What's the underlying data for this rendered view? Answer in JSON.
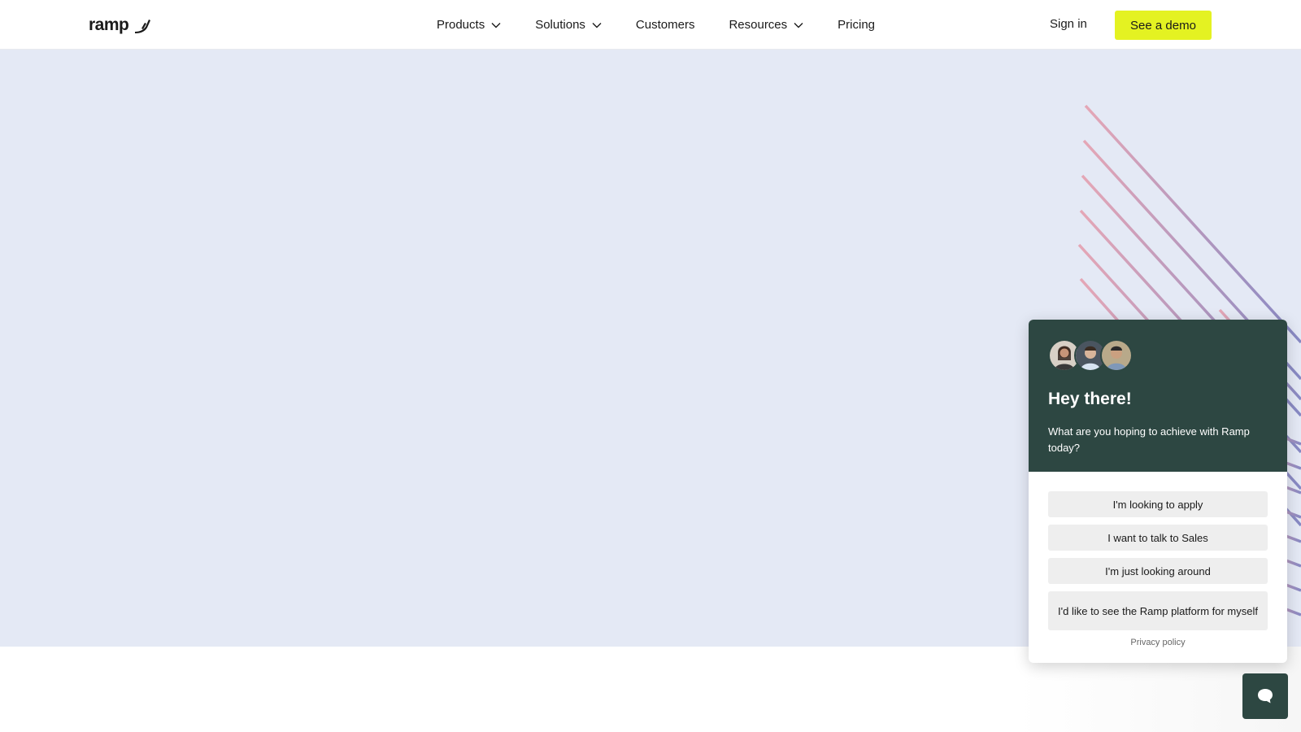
{
  "brand": {
    "name": "ramp"
  },
  "nav": {
    "items": [
      {
        "label": "Products",
        "has_menu": true
      },
      {
        "label": "Solutions",
        "has_menu": true
      },
      {
        "label": "Customers",
        "has_menu": false
      },
      {
        "label": "Resources",
        "has_menu": true
      },
      {
        "label": "Pricing",
        "has_menu": false
      }
    ],
    "sign_in": "Sign in",
    "demo": "See a demo"
  },
  "colors": {
    "accent": "#e4f222",
    "hero_bg": "#e4e9f5",
    "chat_header": "#2d4742",
    "line_pink": "#e5a0b0",
    "line_purple": "#7d7fbf"
  },
  "chat": {
    "title": "Hey there!",
    "subtitle": "What are you hoping to achieve with Ramp today?",
    "options": [
      "I'm looking to apply",
      "I want to talk to Sales",
      "I'm just looking around",
      "I'd like to see the Ramp platform for myself"
    ],
    "privacy": "Privacy policy"
  },
  "icons": {
    "logo_mark": "ramp-logo-mark-icon",
    "chevron": "chevron-down-icon",
    "chat": "chat-bubble-icon"
  }
}
